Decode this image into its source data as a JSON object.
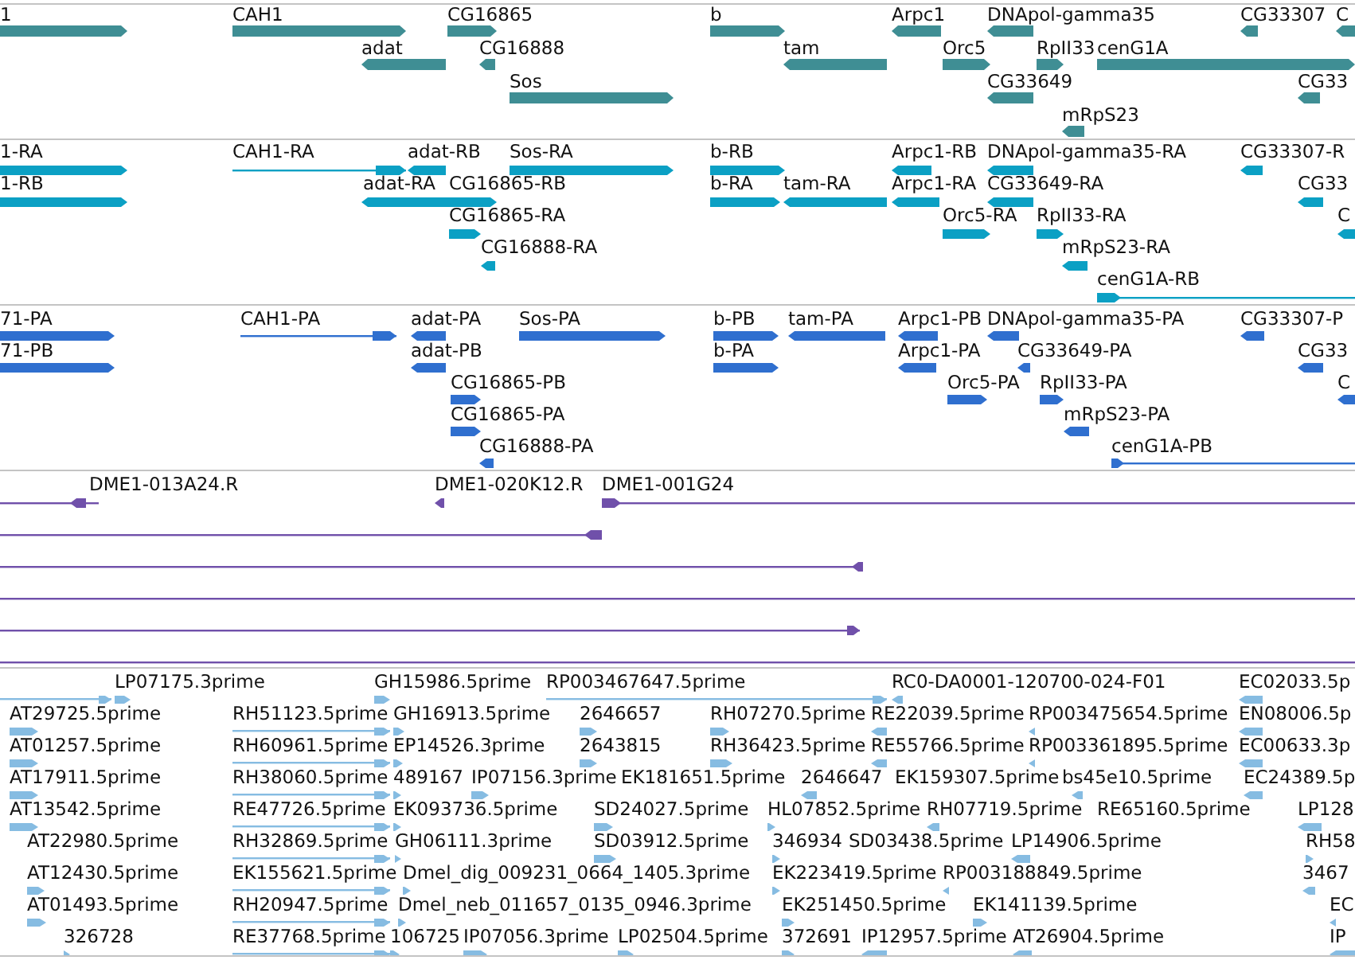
{
  "tracks": [
    {
      "features": [
        {
          "label": "1",
          "kind": "block",
          "reverse": false
        },
        {
          "label": "CAH1",
          "kind": "block",
          "reverse": false
        },
        {
          "label": "CG16865",
          "kind": "block",
          "reverse": false
        },
        {
          "label": "b",
          "kind": "block",
          "reverse": false
        },
        {
          "label": "Arpc1",
          "kind": "block",
          "reverse": true
        },
        {
          "label": "DNApol-gamma35",
          "kind": "block",
          "reverse": true
        },
        {
          "label": "CG33307",
          "kind": "block",
          "reverse": true
        },
        {
          "label": "C",
          "kind": "block",
          "reverse": true
        },
        {
          "label": "adat",
          "kind": "block",
          "reverse": true
        },
        {
          "label": "CG16888",
          "kind": "block",
          "reverse": true
        },
        {
          "label": "tam",
          "kind": "block",
          "reverse": true
        },
        {
          "label": "Orc5",
          "kind": "block",
          "reverse": false
        },
        {
          "label": "RpII33",
          "kind": "block",
          "reverse": false
        },
        {
          "label": "cenG1A",
          "kind": "block",
          "reverse": false
        },
        {
          "label": "Sos",
          "kind": "block",
          "reverse": false
        },
        {
          "label": "CG33649",
          "kind": "block",
          "reverse": true
        },
        {
          "label": "CG33",
          "kind": "block",
          "reverse": true
        },
        {
          "label": "mRpS23",
          "kind": "block",
          "reverse": true
        }
      ]
    },
    {
      "features": [
        {
          "label": "1-RA",
          "kind": "block",
          "reverse": false
        },
        {
          "label": "CAH1-RA",
          "kind": "line",
          "reverse": false
        },
        {
          "label": "adat-RB",
          "kind": "block",
          "reverse": true
        },
        {
          "label": "Sos-RA",
          "kind": "block",
          "reverse": false
        },
        {
          "label": "b-RB",
          "kind": "block",
          "reverse": false
        },
        {
          "label": "Arpc1-RB",
          "kind": "block",
          "reverse": true
        },
        {
          "label": "DNApol-gamma35-RA",
          "kind": "block",
          "reverse": true
        },
        {
          "label": "CG33307-R",
          "kind": "block",
          "reverse": true
        },
        {
          "label": "1-RB",
          "kind": "block",
          "reverse": false
        },
        {
          "label": "adat-RA",
          "kind": "block",
          "reverse": true
        },
        {
          "label": "CG16865-RB",
          "kind": "block",
          "reverse": false
        },
        {
          "label": "b-RA",
          "kind": "block",
          "reverse": false
        },
        {
          "label": "tam-RA",
          "kind": "block",
          "reverse": true
        },
        {
          "label": "Arpc1-RA",
          "kind": "block",
          "reverse": true
        },
        {
          "label": "CG33649-RA",
          "kind": "block",
          "reverse": true
        },
        {
          "label": "CG33",
          "kind": "block",
          "reverse": true
        },
        {
          "label": "CG16865-RA",
          "kind": "block",
          "reverse": false
        },
        {
          "label": "Orc5-RA",
          "kind": "block",
          "reverse": false
        },
        {
          "label": "RpII33-RA",
          "kind": "block",
          "reverse": false
        },
        {
          "label": "C",
          "kind": "block",
          "reverse": true
        },
        {
          "label": "CG16888-RA",
          "kind": "block",
          "reverse": true
        },
        {
          "label": "mRpS23-RA",
          "kind": "block",
          "reverse": true
        },
        {
          "label": "cenG1A-RB",
          "kind": "line",
          "reverse": false
        }
      ]
    },
    {
      "features": [
        {
          "label": "71-PA",
          "kind": "block",
          "reverse": false
        },
        {
          "label": "CAH1-PA",
          "kind": "line",
          "reverse": false
        },
        {
          "label": "adat-PA",
          "kind": "block",
          "reverse": true
        },
        {
          "label": "Sos-PA",
          "kind": "block",
          "reverse": false
        },
        {
          "label": "b-PB",
          "kind": "block",
          "reverse": false
        },
        {
          "label": "tam-PA",
          "kind": "block",
          "reverse": true
        },
        {
          "label": "Arpc1-PB",
          "kind": "block",
          "reverse": true
        },
        {
          "label": "DNApol-gamma35-PA",
          "kind": "block",
          "reverse": true
        },
        {
          "label": "CG33307-P",
          "kind": "block",
          "reverse": true
        },
        {
          "label": "71-PB",
          "kind": "block",
          "reverse": false
        },
        {
          "label": "adat-PB",
          "kind": "block",
          "reverse": true
        },
        {
          "label": "b-PA",
          "kind": "block",
          "reverse": false
        },
        {
          "label": "Arpc1-PA",
          "kind": "block",
          "reverse": true
        },
        {
          "label": "CG33649-PA",
          "kind": "block",
          "reverse": true
        },
        {
          "label": "CG33",
          "kind": "block",
          "reverse": true
        },
        {
          "label": "CG16865-PB",
          "kind": "block",
          "reverse": false
        },
        {
          "label": "Orc5-PA",
          "kind": "block",
          "reverse": false
        },
        {
          "label": "RpII33-PA",
          "kind": "block",
          "reverse": false
        },
        {
          "label": "C",
          "kind": "block",
          "reverse": true
        },
        {
          "label": "CG16865-PA",
          "kind": "block",
          "reverse": false
        },
        {
          "label": "mRpS23-PA",
          "kind": "block",
          "reverse": true
        },
        {
          "label": "CG16888-PA",
          "kind": "block",
          "reverse": true
        },
        {
          "label": "cenG1A-PB",
          "kind": "line",
          "reverse": false
        }
      ]
    },
    {
      "features": [
        {
          "label": "DME1-013A24.R",
          "kind": "line",
          "reverse": true
        },
        {
          "label": "DME1-020K12.R",
          "kind": "block",
          "reverse": true
        },
        {
          "label": "DME1-001G24",
          "kind": "line",
          "reverse": false
        },
        {
          "kind": "line",
          "reverse": true
        },
        {
          "kind": "line",
          "reverse": true
        },
        {
          "kind": "line"
        },
        {
          "kind": "line",
          "reverse": false
        },
        {
          "kind": "line"
        }
      ]
    },
    {
      "features": [
        {
          "kind": "line",
          "reverse": false
        },
        {
          "label": "LP07175.3prime",
          "kind": "block",
          "reverse": false
        },
        {
          "label": "GH15986.5prime",
          "kind": "block",
          "reverse": false
        },
        {
          "label": "RP003467647.5prime",
          "kind": "line",
          "reverse": false
        },
        {
          "label": "RC0-DA0001-120700-024-F01",
          "kind": "block",
          "reverse": true
        },
        {
          "label": "EC02033.5p",
          "kind": "block",
          "reverse": true
        },
        {
          "label": "AT29725.5prime",
          "kind": "block",
          "reverse": false
        },
        {
          "label": "RH51123.5prime",
          "kind": "line",
          "reverse": false
        },
        {
          "label": "GH16913.5prime",
          "kind": "block",
          "reverse": false
        },
        {
          "label": "2646657",
          "kind": "block",
          "reverse": false
        },
        {
          "label": "RH07270.5prime",
          "kind": "block",
          "reverse": false
        },
        {
          "label": "RE22039.5prime",
          "kind": "block",
          "reverse": true
        },
        {
          "label": "RP003475654.5prime",
          "kind": "block",
          "reverse": true
        },
        {
          "label": "EN08006.5p",
          "kind": "block",
          "reverse": true
        },
        {
          "label": "AT01257.5prime",
          "kind": "block",
          "reverse": false
        },
        {
          "label": "RH60961.5prime",
          "kind": "line",
          "reverse": false
        },
        {
          "label": "EP14526.3prime",
          "kind": "block",
          "reverse": false
        },
        {
          "label": "2643815",
          "kind": "block",
          "reverse": false
        },
        {
          "label": "RH36423.5prime",
          "kind": "block",
          "reverse": false
        },
        {
          "label": "RE55766.5prime",
          "kind": "block",
          "reverse": true
        },
        {
          "label": "RP003361895.5prime",
          "kind": "block",
          "reverse": true
        },
        {
          "label": "EC00633.3p",
          "kind": "block",
          "reverse": true
        },
        {
          "label": "AT17911.5prime",
          "kind": "block",
          "reverse": false
        },
        {
          "label": "RH38060.5prime",
          "kind": "line",
          "reverse": false
        },
        {
          "label": "489167",
          "kind": "block",
          "reverse": false
        },
        {
          "label": "IP07156.3prime",
          "kind": "block",
          "reverse": false
        },
        {
          "label": "EK181651.5prime"
        },
        {
          "label": "2646647",
          "kind": "block",
          "reverse": true
        },
        {
          "label": "EK159307.5prime"
        },
        {
          "label": "bs45e10.5prime",
          "kind": "block",
          "reverse": true
        },
        {
          "label": "EC24389.5p",
          "kind": "block",
          "reverse": true
        },
        {
          "label": "AT13542.5prime",
          "kind": "block",
          "reverse": false
        },
        {
          "label": "RE47726.5prime",
          "kind": "line",
          "reverse": false
        },
        {
          "label": "EK093736.5prime",
          "kind": "block",
          "reverse": false
        },
        {
          "label": "SD24027.5prime",
          "kind": "block",
          "reverse": false
        },
        {
          "label": "HL07852.5prime",
          "kind": "block",
          "reverse": false
        },
        {
          "label": "RH07719.5prime",
          "kind": "block",
          "reverse": true
        },
        {
          "label": "RE65160.5prime"
        },
        {
          "label": "LP128",
          "kind": "block",
          "reverse": true
        },
        {
          "label": "AT22980.5prime"
        },
        {
          "label": "RH32869.5prime",
          "kind": "line",
          "reverse": false
        },
        {
          "label": "GH06111.3prime",
          "kind": "block",
          "reverse": false
        },
        {
          "label": "SD03912.5prime",
          "kind": "block",
          "reverse": false
        },
        {
          "label": "346934",
          "kind": "block",
          "reverse": false
        },
        {
          "label": "SD03438.5prime"
        },
        {
          "label": "LP14906.5prime",
          "kind": "block",
          "reverse": true
        },
        {
          "label": "RH58",
          "kind": "block",
          "reverse": false
        },
        {
          "label": "AT12430.5prime",
          "kind": "block",
          "reverse": false
        },
        {
          "label": "EK155621.5prime",
          "kind": "line",
          "reverse": false
        },
        {
          "label": "Dmel_dig_009231_0664_1405.3prime",
          "kind": "block",
          "reverse": false
        },
        {
          "label": "EK223419.5prime",
          "kind": "block",
          "reverse": false
        },
        {
          "label": "RP003188849.5prime",
          "kind": "block",
          "reverse": true
        },
        {
          "label": "3467",
          "kind": "block",
          "reverse": true
        },
        {
          "label": "AT01493.5prime",
          "kind": "block",
          "reverse": false
        },
        {
          "label": "RH20947.5prime",
          "kind": "line",
          "reverse": false
        },
        {
          "label": "Dmel_neb_011657_0135_0946.3prime",
          "kind": "block",
          "reverse": false
        },
        {
          "label": "EK251450.5prime",
          "kind": "block",
          "reverse": false
        },
        {
          "label": "EK141139.5prime",
          "kind": "block",
          "reverse": false
        },
        {
          "label": "EC",
          "kind": "block",
          "reverse": true
        },
        {
          "label": "326728",
          "kind": "block",
          "reverse": false
        },
        {
          "label": "RE37768.5prime",
          "kind": "line",
          "reverse": false
        },
        {
          "label": "106725",
          "kind": "block",
          "reverse": false
        },
        {
          "label": "IP07056.3prime",
          "kind": "block",
          "reverse": false
        },
        {
          "label": "LP02504.5prime",
          "kind": "block",
          "reverse": false
        },
        {
          "label": "372691",
          "kind": "block",
          "reverse": false
        },
        {
          "label": "IP12957.5prime",
          "kind": "block",
          "reverse": true
        },
        {
          "label": "AT26904.5prime",
          "kind": "block",
          "reverse": true
        },
        {
          "label": "IP",
          "kind": "block",
          "reverse": true
        }
      ]
    }
  ]
}
